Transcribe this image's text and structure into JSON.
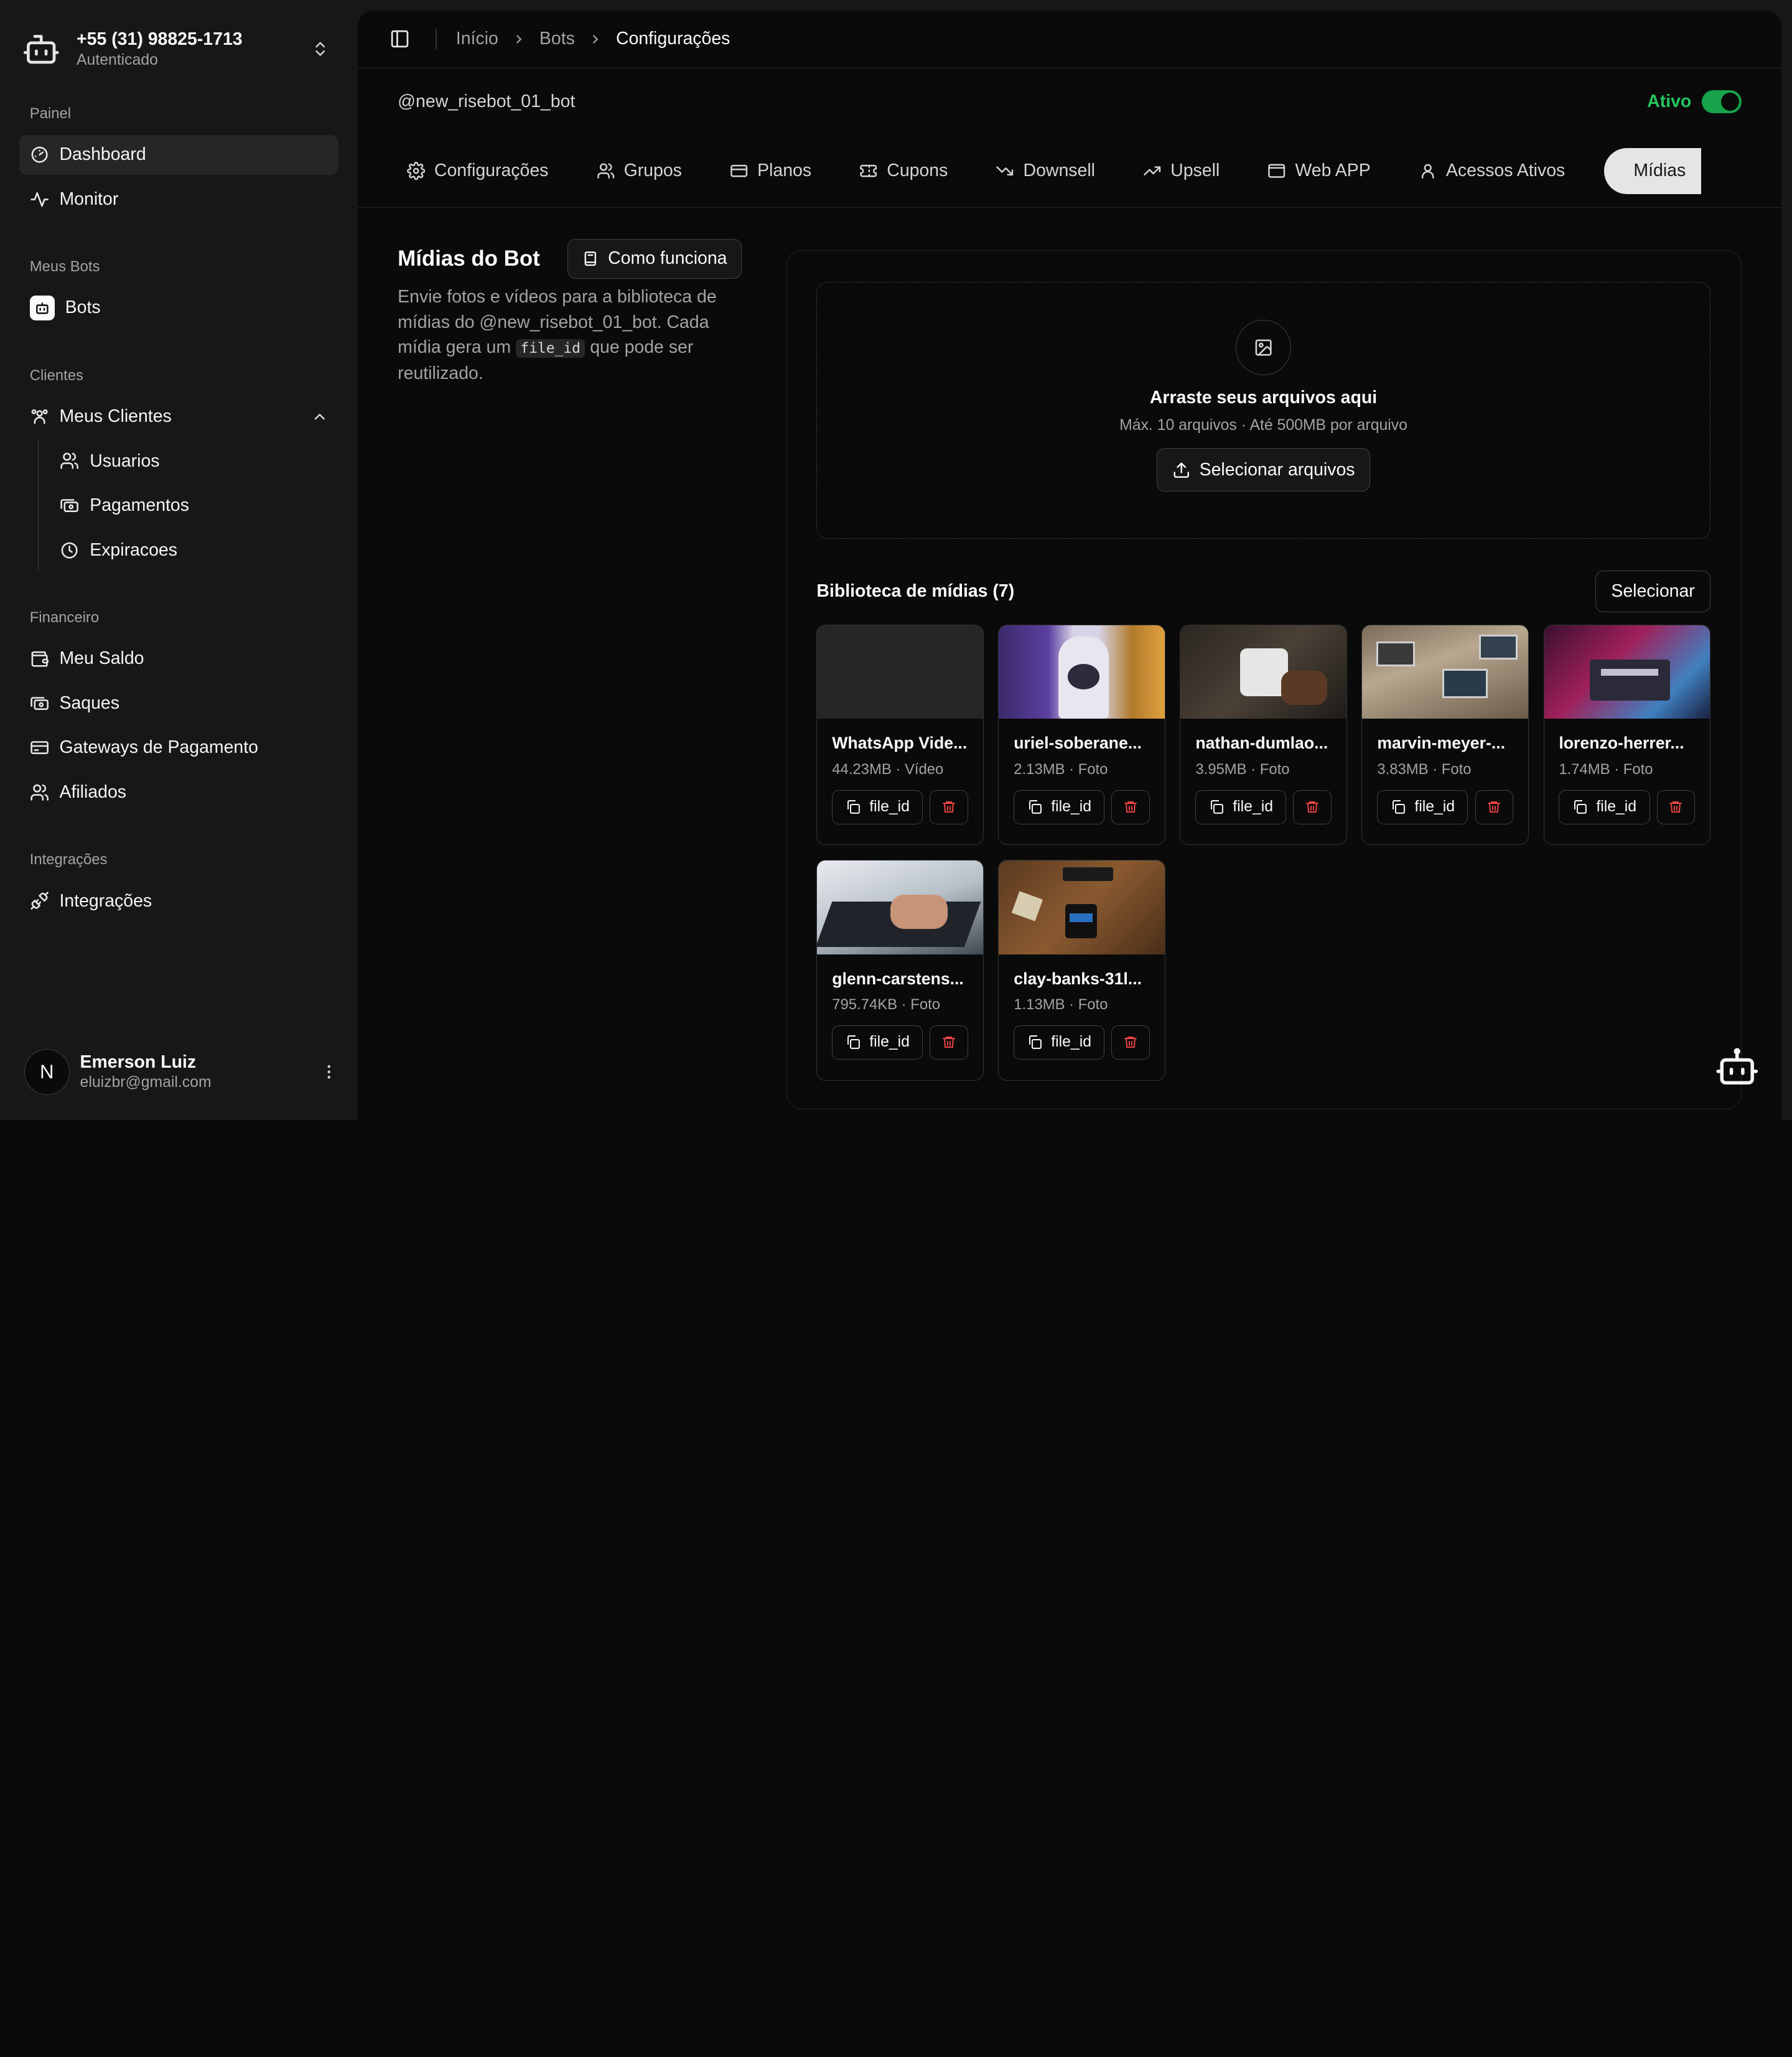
{
  "account": {
    "phone": "+55 (31) 98825-1713",
    "status": "Autenticado"
  },
  "sidebar": {
    "groups": [
      {
        "label": "Painel"
      },
      {
        "label": "Meus Bots"
      },
      {
        "label": "Clientes"
      },
      {
        "label": "Financeiro"
      },
      {
        "label": "Integrações"
      }
    ],
    "items": {
      "dashboard": "Dashboard",
      "monitor": "Monitor",
      "bots": "Bots",
      "meus_clientes": "Meus Clientes",
      "usuarios": "Usuarios",
      "pagamentos": "Pagamentos",
      "expiracoes": "Expiracoes",
      "meu_saldo": "Meu Saldo",
      "saques": "Saques",
      "gateways": "Gateways de Pagamento",
      "afiliados": "Afiliados",
      "integracoes": "Integrações"
    }
  },
  "user": {
    "initial": "N",
    "name": "Emerson Luiz",
    "email": "eluizbr@gmail.com"
  },
  "breadcrumb": [
    "Início",
    "Bots",
    "Configurações"
  ],
  "bot": {
    "handle": "@new_risebot_01_bot",
    "active_label": "Ativo",
    "active": true
  },
  "tabs": [
    "Configurações",
    "Grupos",
    "Planos",
    "Cupons",
    "Downsell",
    "Upsell",
    "Web APP",
    "Acessos Ativos",
    "Mídias"
  ],
  "section": {
    "title": "Mídias do Bot",
    "how_button": "Como funciona",
    "desc_before": "Envie fotos e vídeos para a biblioteca de mídias do @new_risebot_01_bot. Cada mídia gera um ",
    "desc_code": "file_id",
    "desc_after": " que pode ser reutilizado."
  },
  "dropzone": {
    "title": "Arraste seus arquivos aqui",
    "subtitle": "Máx. 10 arquivos · Até 500MB por arquivo",
    "button": "Selecionar arquivos"
  },
  "library": {
    "title": "Biblioteca de mídias (7)",
    "select_button": "Selecionar",
    "file_id_label": "file_id",
    "items": [
      {
        "name": "WhatsApp Vide...",
        "meta": "44.23MB · Vídeo"
      },
      {
        "name": "uriel-soberane...",
        "meta": "2.13MB · Foto"
      },
      {
        "name": "nathan-dumlao...",
        "meta": "3.95MB · Foto"
      },
      {
        "name": "marvin-meyer-...",
        "meta": "3.83MB · Foto"
      },
      {
        "name": "lorenzo-herrer...",
        "meta": "1.74MB · Foto"
      },
      {
        "name": "glenn-carstens...",
        "meta": "795.74KB · Foto"
      },
      {
        "name": "clay-banks-31l...",
        "meta": "1.13MB · Foto"
      }
    ]
  },
  "colors": {
    "accent_active": "#22c55e",
    "danger": "#ef4444",
    "background": "#0a0a0a",
    "sidebar": "#171717"
  }
}
